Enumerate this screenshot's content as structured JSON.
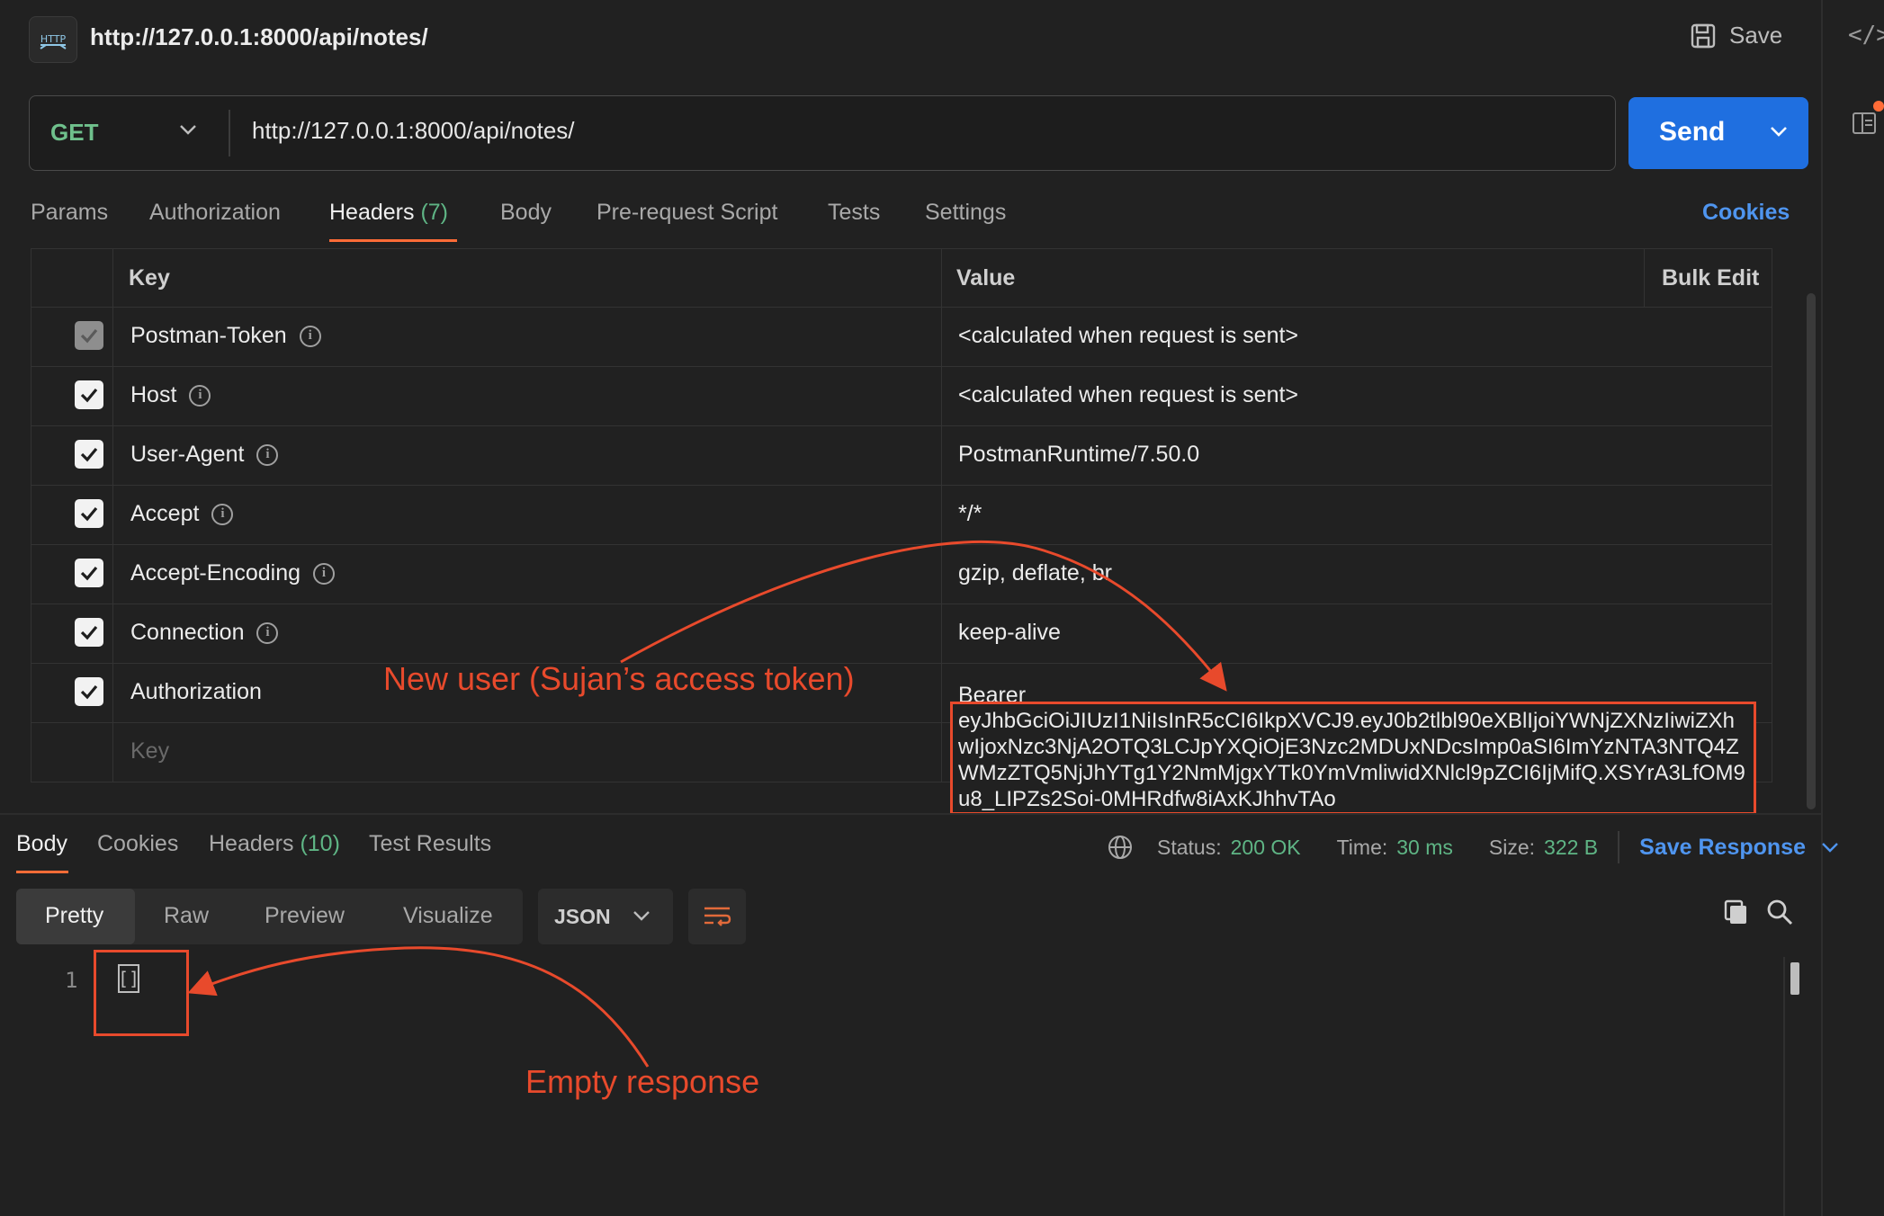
{
  "title_bar": {
    "badge": "HTTP",
    "url": "http://127.0.0.1:8000/api/notes/",
    "save_label": "Save"
  },
  "request": {
    "method": "GET",
    "url": "http://127.0.0.1:8000/api/notes/",
    "send_label": "Send"
  },
  "request_tabs": [
    {
      "label": "Params"
    },
    {
      "label": "Authorization"
    },
    {
      "label": "Headers",
      "count": "(7)",
      "active": true
    },
    {
      "label": "Body"
    },
    {
      "label": "Pre-request Script"
    },
    {
      "label": "Tests"
    },
    {
      "label": "Settings"
    }
  ],
  "cookies_label": "Cookies",
  "headers_table": {
    "columns": {
      "key": "Key",
      "value": "Value",
      "bulk_edit": "Bulk Edit"
    },
    "rows": [
      {
        "key": "Postman-Token",
        "value": "<calculated when request is sent>",
        "checked": true,
        "disabled": true
      },
      {
        "key": "Host",
        "value": "<calculated when request is sent>",
        "checked": true
      },
      {
        "key": "User-Agent",
        "value": "PostmanRuntime/7.50.0",
        "checked": true
      },
      {
        "key": "Accept",
        "value": "*/*",
        "checked": true
      },
      {
        "key": "Accept-Encoding",
        "value": "gzip, deflate, br",
        "checked": true
      },
      {
        "key": "Connection",
        "value": "keep-alive",
        "checked": true
      },
      {
        "key": "Authorization",
        "value": "Bearer",
        "checked": true
      }
    ],
    "token": "eyJhbGciOiJIUzI1NiIsInR5cCI6IkpXVCJ9.eyJ0b2tlbl90eXBlIjoiYWNjZXNzIiwiZXhwIjoxNzc3NjA2OTQ3LCJpYXQiOjE3Nzc2MDUxNDcsImp0aSI6ImYzNTA3NTQ4ZWMzZTQ5NjJhYTg1Y2NmMjgxYTk0YmVmliwidXNlcl9pZCI6IjMifQ.XSYrA3LfOM9u8_LIPZs2Soi-0MHRdfw8iAxKJhhvTAo",
    "key_placeholder": "Key"
  },
  "response_tabs": [
    {
      "label": "Body",
      "active": true
    },
    {
      "label": "Cookies"
    },
    {
      "label": "Headers",
      "count": "(10)"
    },
    {
      "label": "Test Results"
    }
  ],
  "response_status": {
    "status_label": "Status:",
    "status_value": "200 OK",
    "time_label": "Time:",
    "time_value": "30 ms",
    "size_label": "Size:",
    "size_value": "322 B",
    "save_response": "Save Response"
  },
  "view_modes": [
    "Pretty",
    "Raw",
    "Preview",
    "Visualize"
  ],
  "format": "JSON",
  "code": {
    "line_number": "1",
    "content": "[]"
  },
  "annotations": {
    "token_note": "New user (Sujan’s access token)",
    "empty_note": "Empty response"
  },
  "colors": {
    "background": "#212121",
    "accent_orange": "#ff6c37",
    "send_blue": "#1f6fe0",
    "link_blue": "#4f95ef",
    "green": "#5fb585",
    "annotation_red": "#e84a2c"
  }
}
